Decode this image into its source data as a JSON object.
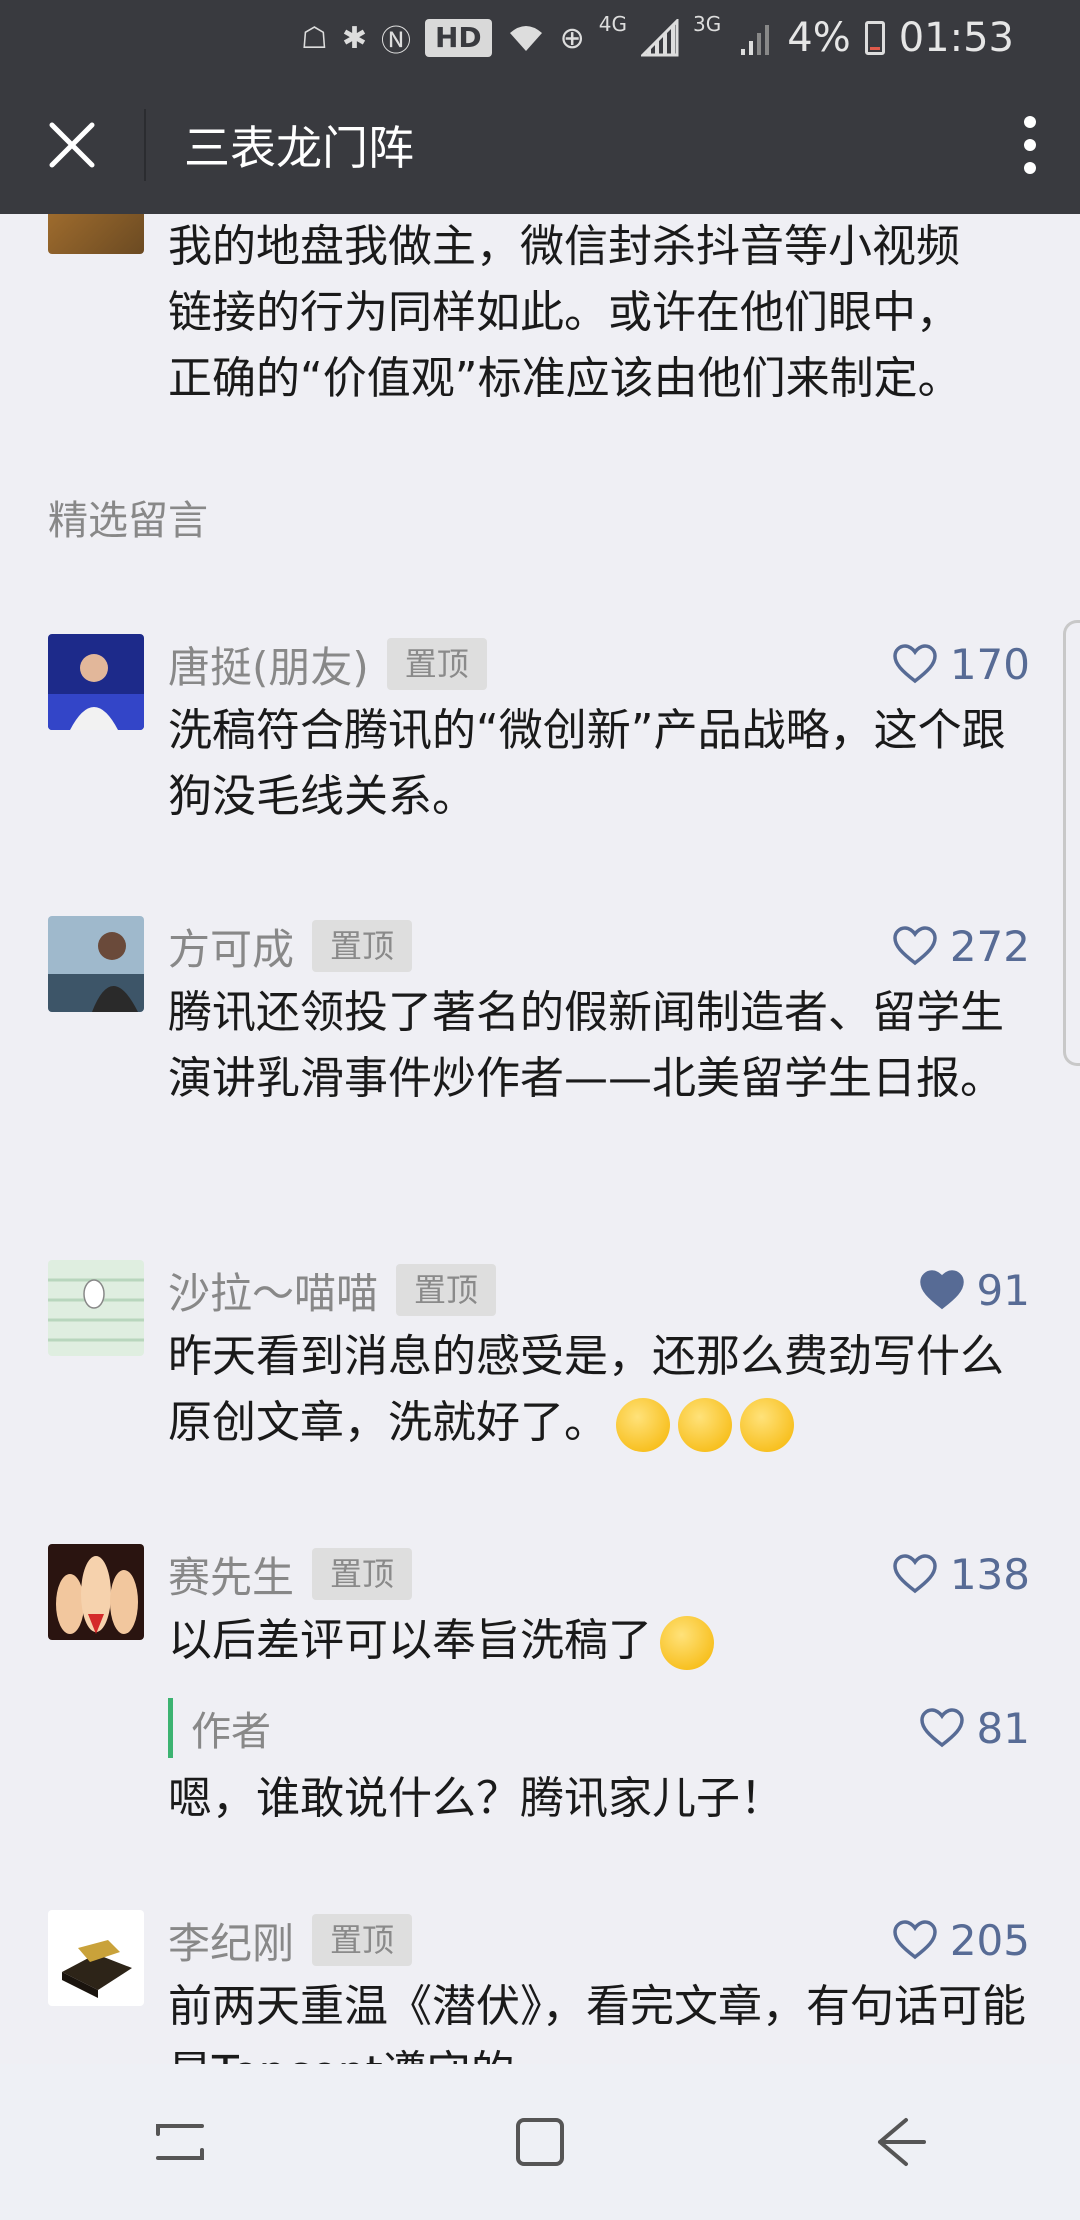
{
  "status_bar": {
    "hd": "HD",
    "net_4g": "4G",
    "net_3g": "3G",
    "battery": "4%",
    "time": "01:53"
  },
  "titlebar": {
    "title": "三表龙门阵"
  },
  "article": {
    "text_lines": [
      "我的地盘我做主，微信封杀抖音等小视频",
      "链接的行为同样如此。或许在他们眼中，",
      "正确的“价值观”标准应该由他们来制定。"
    ]
  },
  "section": {
    "title": "精选留言"
  },
  "pin_label": "置顶",
  "comments": [
    {
      "name": "唐挺(朋友)",
      "likes": "170",
      "liked": false,
      "text": "洗稿符合腾讯的“微创新”产品战略，这个跟狗没毛线关系。"
    },
    {
      "name": "方可成",
      "likes": "272",
      "liked": false,
      "text": "腾讯还领投了著名的假新闻制造者、留学生演讲乳滑事件炒作者——北美留学生日报。"
    },
    {
      "name": "沙拉～喵喵",
      "likes": "91",
      "liked": true,
      "text": "昨天看到消息的感受是，还那么费劲写什么原创文章，洗就好了。"
    },
    {
      "name": "赛先生",
      "likes": "138",
      "liked": false,
      "text": "以后差评可以奉旨洗稿了",
      "reply": {
        "author": "作者",
        "likes": "81",
        "text": "嗯，谁敢说什么？腾讯家儿子！"
      }
    },
    {
      "name": "李纪刚",
      "likes": "205",
      "liked": false,
      "text": "前两天重温《潜伏》，看完文章，有句话可能是Tencent遵守的。"
    }
  ],
  "colors": {
    "bar": "#393a3f",
    "background": "#efeff4",
    "link": "#576b95",
    "reply_accent": "#3cb371"
  }
}
